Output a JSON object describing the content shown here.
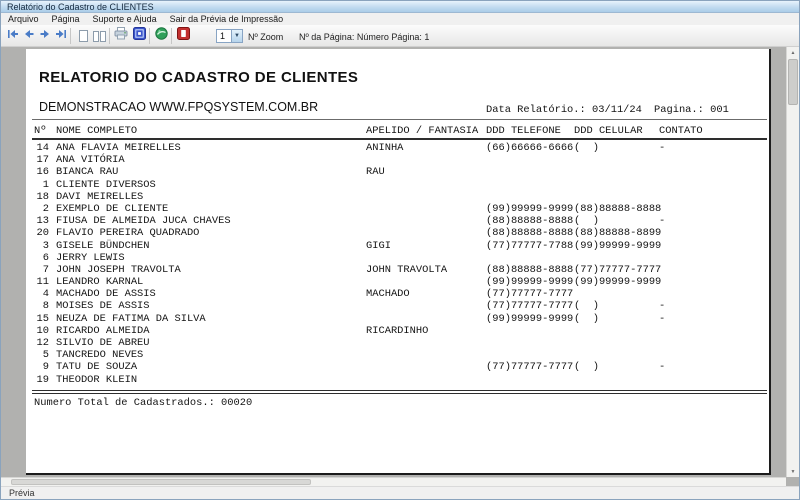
{
  "window": {
    "title": "Relatório do Cadastro de CLIENTES"
  },
  "menu": {
    "items": [
      "Arquivo",
      "Página",
      "Suporte e Ajuda",
      "Sair da Prévia de Impressão"
    ]
  },
  "toolbar": {
    "zoom_value": "1",
    "zoom_label": "Nº Zoom",
    "page_info": "Nº da Página: Número Página: 1",
    "icons": {
      "nav": [
        "first-page-icon",
        "prev-page-icon",
        "next-page-icon",
        "last-page-icon"
      ],
      "view": [
        "single-page-icon",
        "two-page-icon"
      ],
      "actions": [
        "printer-icon",
        "printer-config-icon",
        "globe-icon",
        "exit-icon"
      ]
    }
  },
  "report": {
    "title": "RELATORIO DO CADASTRO DE CLIENTES",
    "subtitle": "DEMONSTRACAO WWW.FPQSYSTEM.COM.BR",
    "date_label": "Data Relatório.: 03/11/24",
    "page_label": "Pagina.: 001",
    "columns": [
      "Nº",
      "NOME COMPLETO",
      "APELIDO / FANTASIA",
      "DDD TELEFONE",
      "DDD CELULAR",
      "CONTATO"
    ],
    "rows": [
      [
        "14",
        "ANA FLAVIA MEIRELLES",
        "ANINHA",
        "(66)66666-6666",
        "(  )",
        "-"
      ],
      [
        "17",
        "ANA VITÓRIA",
        "",
        "",
        "",
        ""
      ],
      [
        "16",
        "BIANCA RAU",
        "RAU",
        "",
        "",
        ""
      ],
      [
        "1",
        "CLIENTE DIVERSOS",
        "",
        "",
        "",
        ""
      ],
      [
        "18",
        "DAVI MEIRELLES",
        "",
        "",
        "",
        ""
      ],
      [
        "2",
        "EXEMPLO DE CLIENTE",
        "",
        "(99)99999-9999",
        "(88)88888-8888",
        ""
      ],
      [
        "13",
        "FIUSA DE ALMEIDA JUCA CHAVES",
        "",
        "(88)88888-8888",
        "(  )",
        "-"
      ],
      [
        "20",
        "FLAVIO PEREIRA QUADRADO",
        "",
        "(88)88888-8888",
        "(88)88888-8899",
        ""
      ],
      [
        "3",
        "GISELE BÜNDCHEN",
        "GIGI",
        "(77)77777-7788",
        "(99)99999-9999",
        ""
      ],
      [
        "6",
        "JERRY LEWIS",
        "",
        "",
        "",
        ""
      ],
      [
        "7",
        "JOHN JOSEPH TRAVOLTA",
        "JOHN TRAVOLTA",
        "(88)88888-8888",
        "(77)77777-7777",
        ""
      ],
      [
        "11",
        "LEANDRO KARNAL",
        "",
        "(99)99999-9999",
        "(99)99999-9999",
        ""
      ],
      [
        "4",
        "MACHADO DE ASSIS",
        "MACHADO",
        "(77)77777-7777",
        "",
        ""
      ],
      [
        "8",
        "MOISES DE ASSIS",
        "",
        "(77)77777-7777",
        "(  )",
        "-"
      ],
      [
        "15",
        "NEUZA DE FATIMA DA SILVA",
        "",
        "(99)99999-9999",
        "(  )",
        "-"
      ],
      [
        "10",
        "RICARDO ALMEIDA",
        "RICARDINHO",
        "",
        "",
        ""
      ],
      [
        "12",
        "SILVIO DE ABREU",
        "",
        "",
        "",
        ""
      ],
      [
        "5",
        "TANCREDO NEVES",
        "",
        "",
        "",
        ""
      ],
      [
        "9",
        "TATU DE SOUZA",
        "",
        "(77)77777-7777",
        "(  )",
        "-"
      ],
      [
        "19",
        "THEODOR KLEIN",
        "",
        "",
        "",
        ""
      ]
    ],
    "total_label": "Numero Total de Cadastrados.: 00020"
  },
  "statusbar": {
    "text": "Prévia"
  },
  "colors": {
    "titlebar_bg": "#c2dbf0",
    "preview_bg": "#b1b1af",
    "nav_arrow_blue": "#4a7cc7",
    "config_blue": "#3b55cb",
    "globe_green": "#2fa05a",
    "exit_red": "#c23030"
  }
}
